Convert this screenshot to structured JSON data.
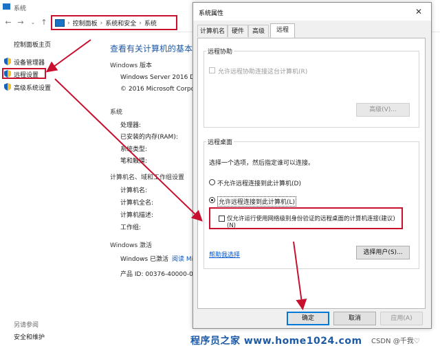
{
  "background_window": {
    "title": "系统",
    "breadcrumb": [
      "控制面板",
      "系统和安全",
      "系统"
    ],
    "sidebar": {
      "home": "控制面板主页",
      "items": [
        "设备管理器",
        "远程设置",
        "高级系统设置"
      ],
      "see_also_title": "另请参阅",
      "see_also": [
        "安全和维护"
      ]
    },
    "main": {
      "title": "查看有关计算机的基本信",
      "windows_edition_label": "Windows 版本",
      "edition_value": "Windows Server 2016 Da",
      "copyright_value": "© 2016 Microsoft Corpo",
      "system_label": "系统",
      "processor_label": "处理器:",
      "ram_label": "已安装的内存(RAM):",
      "system_type_label": "系统类型:",
      "pen_touch_label": "笔和触摸:",
      "computer_section_label": "计算机名、域和工作组设置",
      "computer_name_label": "计算机名:",
      "full_name_label": "计算机全名:",
      "description_label": "计算机描述:",
      "workgroup_label": "工作组:",
      "activation_label": "Windows 激活",
      "activated_text": "Windows 已激活",
      "read_link": "阅读 Mi",
      "product_id": "产品 ID: 00376-40000-00"
    }
  },
  "dialog": {
    "title": "系统属性",
    "close_glyph": "✕",
    "tabs": [
      "计算机名",
      "硬件",
      "高级",
      "远程"
    ],
    "active_tab": "远程",
    "remote_assistance": {
      "group_title": "远程协助",
      "checkbox_label": "允许远程协助连接这台计算机(R)",
      "advanced_button": "高级(V)..."
    },
    "remote_desktop": {
      "group_title": "远程桌面",
      "instruction": "选择一个选项，然后指定谁可以连接。",
      "option_deny": "不允许远程连接到此计算机(D)",
      "option_allow": "允许远程连接到此计算机(L)",
      "nla_checkbox_line1": "仅允许运行使用网络级别身份验证的远程桌面的计算机连接(建议)",
      "nla_checkbox_line2": "(N)",
      "help_link": "帮助我选择",
      "select_users_button": "选择用户(S)..."
    },
    "buttons": {
      "ok": "确定",
      "cancel": "取消",
      "apply": "应用(A)"
    }
  },
  "watermark": "程序员之家 www.home1024.com",
  "csdn_credit": "CSDN @千我♡",
  "colors": {
    "annotation_red": "#c8102e",
    "link_blue": "#1d5aa6",
    "primary_blue": "#0078d7"
  },
  "icons": [
    "computer-icon",
    "shield-icon",
    "back-arrow-icon",
    "forward-arrow-icon",
    "up-arrow-icon",
    "close-icon"
  ]
}
